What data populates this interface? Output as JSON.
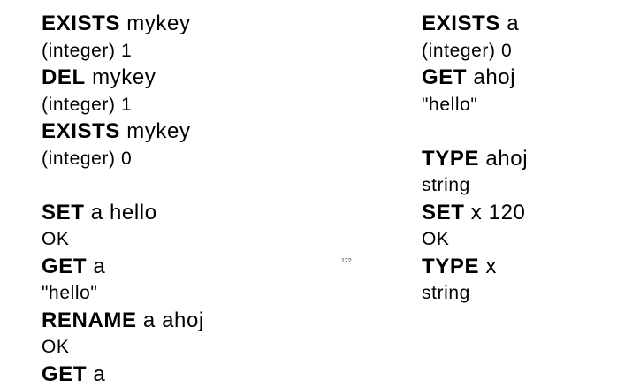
{
  "left_column": {
    "block1": [
      {
        "kind": "cmd",
        "kw": "EXISTS",
        "args": " mykey"
      },
      {
        "kind": "out",
        "text": "(integer) 1"
      },
      {
        "kind": "cmd",
        "kw": "DEL",
        "args": " mykey"
      },
      {
        "kind": "out",
        "text": "(integer) 1"
      },
      {
        "kind": "cmd",
        "kw": "EXISTS",
        "args": " mykey"
      },
      {
        "kind": "out",
        "text": "(integer) 0"
      }
    ],
    "block2": [
      {
        "kind": "cmd",
        "kw": "SET",
        "args": " a hello"
      },
      {
        "kind": "out",
        "text": "OK"
      },
      {
        "kind": "cmd",
        "kw": "GET",
        "args": " a"
      },
      {
        "kind": "out",
        "text": "\"hello\""
      },
      {
        "kind": "cmd",
        "kw": "RENAME",
        "args": " a ahoj"
      },
      {
        "kind": "out",
        "text": "OK"
      },
      {
        "kind": "cmd",
        "kw": "GET",
        "args": " a"
      }
    ]
  },
  "right_column": {
    "block1": [
      {
        "kind": "cmd",
        "kw": "EXISTS",
        "args": " a"
      },
      {
        "kind": "out",
        "text": "(integer) 0"
      },
      {
        "kind": "cmd",
        "kw": "GET",
        "args": " ahoj"
      },
      {
        "kind": "out",
        "text": "\"hello\""
      }
    ],
    "block2": [
      {
        "kind": "cmd",
        "kw": "TYPE",
        "args": " ahoj"
      },
      {
        "kind": "out",
        "text": "string"
      },
      {
        "kind": "cmd",
        "kw": "SET",
        "args": " x 120"
      },
      {
        "kind": "out",
        "text": "OK"
      },
      {
        "kind": "cmd",
        "kw": "TYPE",
        "args": " x"
      },
      {
        "kind": "out",
        "text": "string"
      }
    ]
  },
  "page_number": "122"
}
